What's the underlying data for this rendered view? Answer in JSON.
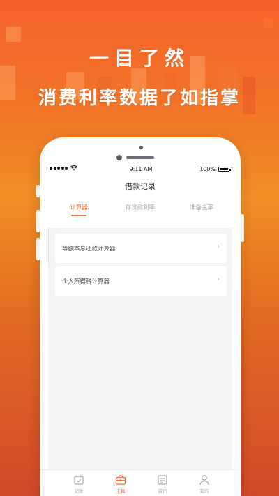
{
  "hero": {
    "title_line1": "一目了然",
    "title_line2": "消费利率数据了如指掌"
  },
  "status_bar": {
    "time": "9:11 AM",
    "battery": "100%"
  },
  "screen": {
    "title": "借款记录",
    "tabs": [
      {
        "label": "计算器",
        "active": true
      },
      {
        "label": "存贷款利率",
        "active": false
      },
      {
        "label": "准备金率",
        "active": false
      }
    ],
    "items": [
      {
        "label": "等额本息还款计算器",
        "chevron": "›"
      },
      {
        "label": "个人所得税计算器",
        "chevron": "›"
      }
    ]
  },
  "tabbar": {
    "items": [
      {
        "label": "记账",
        "icon": "calendar-check-icon",
        "active": false
      },
      {
        "label": "工具",
        "icon": "briefcase-icon",
        "active": true
      },
      {
        "label": "资讯",
        "icon": "news-card-icon",
        "active": false
      },
      {
        "label": "我的",
        "icon": "user-icon",
        "active": false
      }
    ]
  },
  "colors": {
    "accent": "#f46b3a",
    "bg_top": "#f4622a",
    "bg_bottom": "#d2492a"
  }
}
